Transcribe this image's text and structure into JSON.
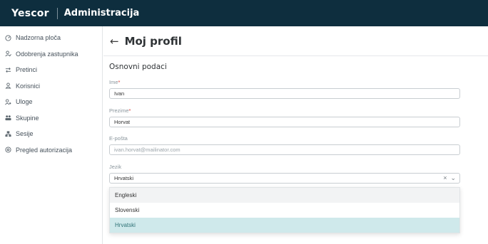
{
  "header": {
    "logo": "Yescor",
    "app_title": "Administracija"
  },
  "sidebar": {
    "items": [
      {
        "label": "Nadzorna ploča",
        "icon": "dashboard-icon"
      },
      {
        "label": "Odobrenja zastupnika",
        "icon": "user-check-icon"
      },
      {
        "label": "Pretinci",
        "icon": "swap-icon"
      },
      {
        "label": "Korisnici",
        "icon": "user-icon"
      },
      {
        "label": "Uloge",
        "icon": "user-role-icon"
      },
      {
        "label": "Skupine",
        "icon": "group-icon"
      },
      {
        "label": "Sesije",
        "icon": "sessions-icon"
      },
      {
        "label": "Pregled autorizacija",
        "icon": "shield-icon"
      }
    ]
  },
  "page": {
    "back_icon": "arrow-left-icon",
    "title": "Moj profil",
    "section_title": "Osnovni podaci"
  },
  "form": {
    "first_name": {
      "label": "Ime",
      "required_mark": "*",
      "value": "Ivan"
    },
    "last_name": {
      "label": "Prezime",
      "required_mark": "*",
      "value": "Horvat"
    },
    "email": {
      "label": "E-pošta",
      "value": "ivan.horvat@mailinator.com"
    },
    "language": {
      "label": "Jezik",
      "value": "Hrvatski",
      "clear_icon": "×",
      "chevron_icon": "⌄",
      "options": [
        "Engleski",
        "Slovenski",
        "Hrvatski"
      ]
    }
  }
}
